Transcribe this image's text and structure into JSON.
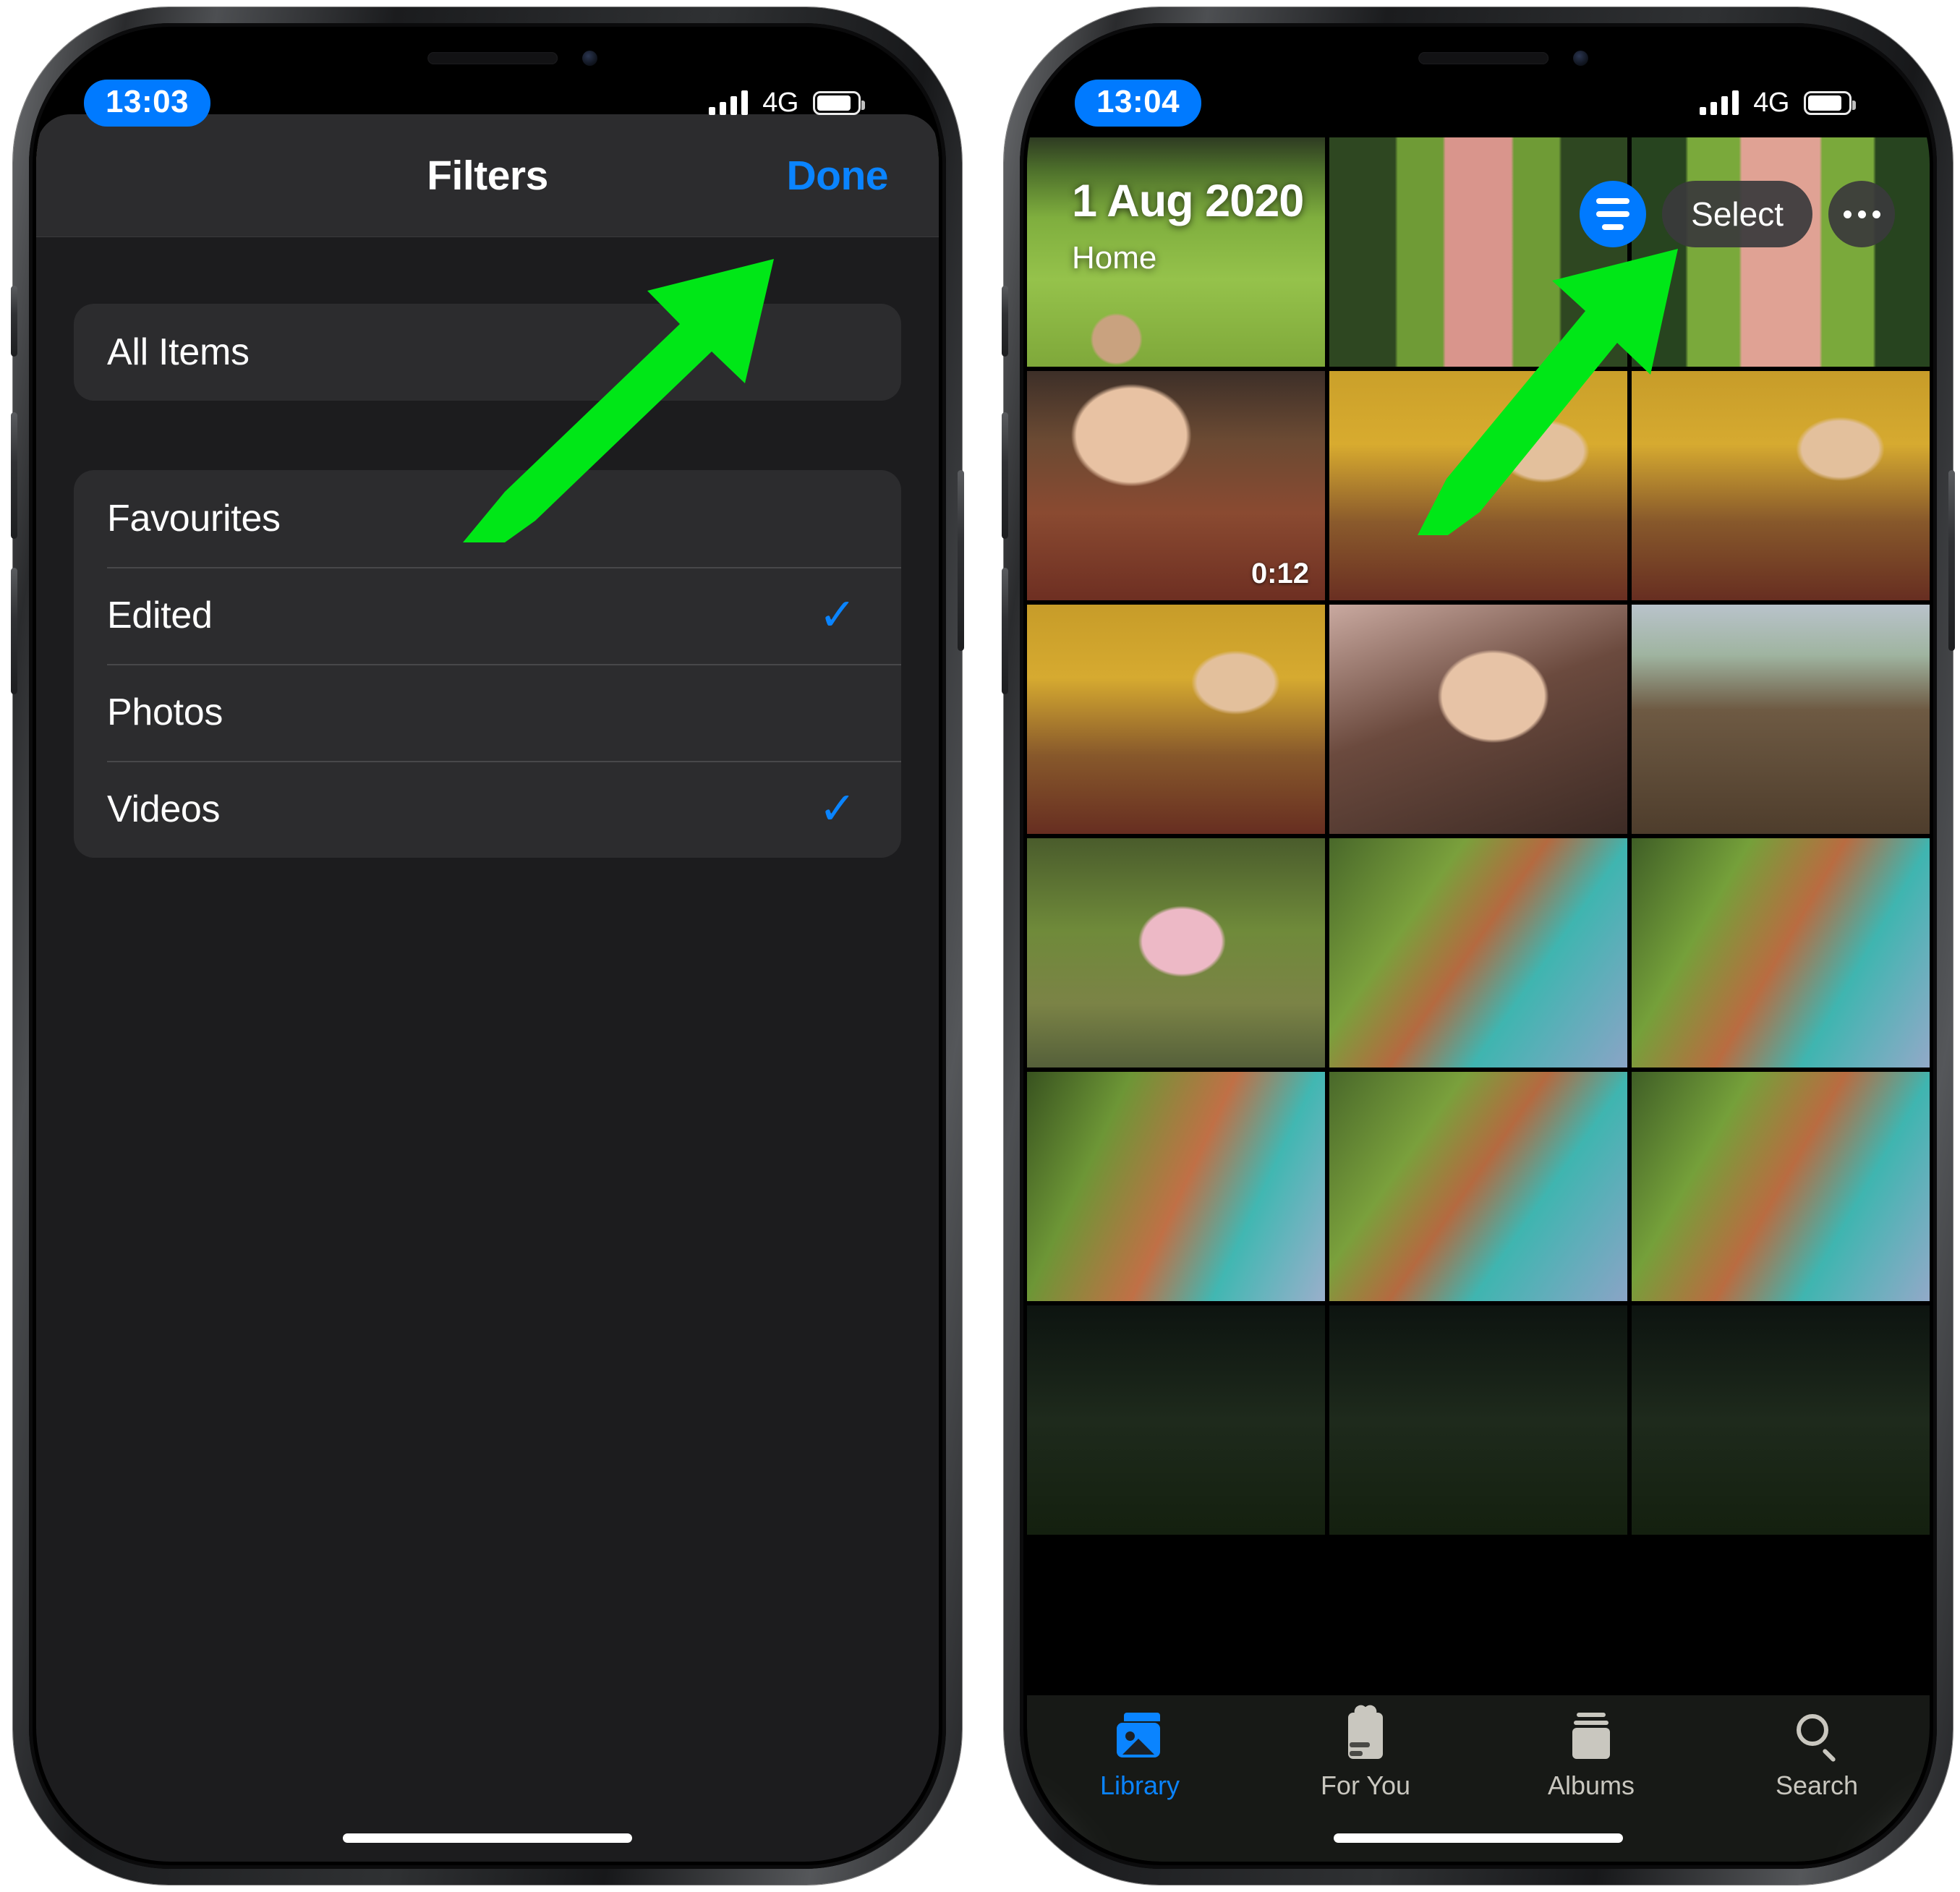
{
  "accent": {
    "ios_blue": "#0a84ff",
    "tint_blue": "#007aff",
    "arrow_green": "#00e717"
  },
  "left_phone": {
    "status": {
      "time": "13:03",
      "network": "4G",
      "signal_bars": 4,
      "battery_level": "86"
    },
    "sheet": {
      "title": "Filters",
      "done_label": "Done",
      "group_all": [
        {
          "label": "All Items",
          "checked": false
        }
      ],
      "group_types": [
        {
          "label": "Favourites",
          "checked": false
        },
        {
          "label": "Edited",
          "checked": true
        },
        {
          "label": "Photos",
          "checked": false
        },
        {
          "label": "Videos",
          "checked": true
        }
      ],
      "check_glyph": "✓"
    }
  },
  "right_phone": {
    "status": {
      "time": "13:04",
      "network": "4G",
      "signal_bars": 4,
      "battery_level": "86"
    },
    "header": {
      "date": "1 Aug 2020",
      "location": "Home",
      "filter_button_label": "filter",
      "select_label": "Select",
      "more_label": "···"
    },
    "grid": {
      "cells": [
        {
          "style": "p-garden1",
          "duration": ""
        },
        {
          "style": "p-garden2",
          "duration": ""
        },
        {
          "style": "p-garden3",
          "duration": ""
        },
        {
          "style": "p-dinner1",
          "duration": "0:12"
        },
        {
          "style": "p-dinner2",
          "duration": ""
        },
        {
          "style": "p-dinner3",
          "duration": ""
        },
        {
          "style": "p-dinner3",
          "duration": ""
        },
        {
          "style": "p-kiss",
          "duration": ""
        },
        {
          "style": "p-field",
          "duration": ""
        },
        {
          "style": "p-pink",
          "duration": ""
        },
        {
          "style": "p-bridge1",
          "duration": ""
        },
        {
          "style": "p-bridge2",
          "duration": ""
        },
        {
          "style": "p-bridge3",
          "duration": ""
        },
        {
          "style": "p-bridge1",
          "duration": ""
        },
        {
          "style": "p-bridge2",
          "duration": ""
        },
        {
          "style": "p-dark",
          "duration": ""
        },
        {
          "style": "p-dark",
          "duration": ""
        },
        {
          "style": "p-dark",
          "duration": ""
        }
      ]
    },
    "tabs": [
      {
        "label": "Library",
        "icon": "library-icon",
        "active": true
      },
      {
        "label": "For You",
        "icon": "for-you-icon",
        "active": false
      },
      {
        "label": "Albums",
        "icon": "albums-icon",
        "active": false
      },
      {
        "label": "Search",
        "icon": "search-icon",
        "active": false
      }
    ]
  }
}
